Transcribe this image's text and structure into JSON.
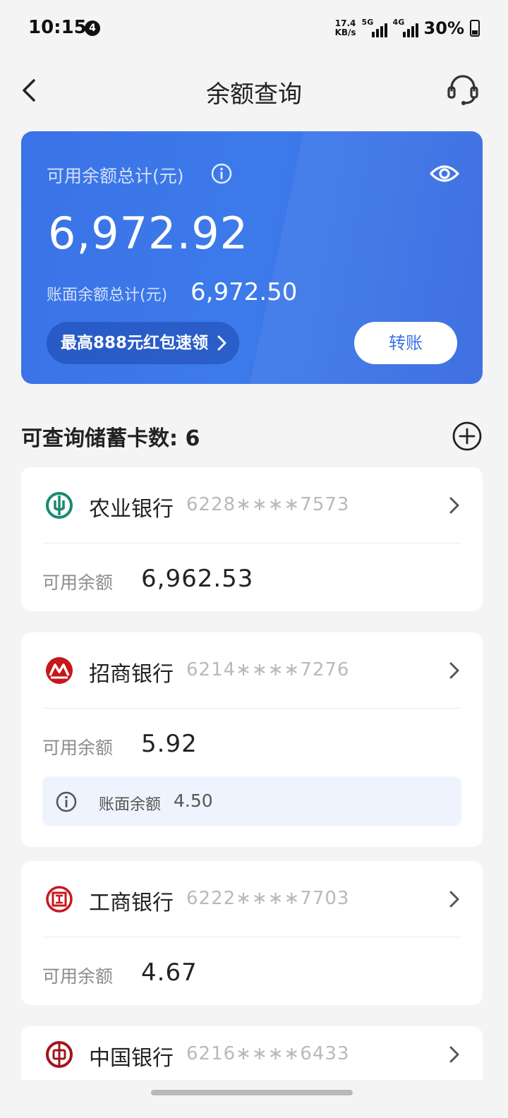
{
  "status_bar": {
    "time": "10:15",
    "notification_count": "4",
    "net_speed_value": "17.4",
    "net_speed_unit": "KB/s",
    "signal1_tag": "5G",
    "signal2_tag": "4G",
    "battery": "30%"
  },
  "nav": {
    "title": "余额查询",
    "back_icon": "chevron-left-icon",
    "service_icon": "headset-icon"
  },
  "summary": {
    "available_label": "可用余额总计(元)",
    "available_amount": "6,972.92",
    "book_label": "账面余额总计(元)",
    "book_amount": "6,972.50",
    "promo_label": "最高888元红包速领",
    "transfer_label": "转账",
    "accent_color": "#3a73e6"
  },
  "section": {
    "title": "可查询储蓄卡数: 6"
  },
  "cards": [
    {
      "bank": "农业银行",
      "number": "6228∗∗∗∗7573",
      "balance_label": "可用余额",
      "balance": "6,962.53",
      "logo_icon": "abc-bank-logo",
      "logo_color": "#1a8a6e"
    },
    {
      "bank": "招商银行",
      "number": "6214∗∗∗∗7276",
      "balance_label": "可用余额",
      "balance": "5.92",
      "book_label": "账面余额",
      "book_value": "4.50",
      "logo_icon": "cmb-bank-logo",
      "logo_color": "#c8161d"
    },
    {
      "bank": "工商银行",
      "number": "6222∗∗∗∗7703",
      "balance_label": "可用余额",
      "balance": "4.67",
      "logo_icon": "icbc-bank-logo",
      "logo_color": "#c8161d"
    },
    {
      "bank": "中国银行",
      "number": "6216∗∗∗∗6433",
      "logo_icon": "boc-bank-logo",
      "logo_color": "#a3141c"
    }
  ]
}
